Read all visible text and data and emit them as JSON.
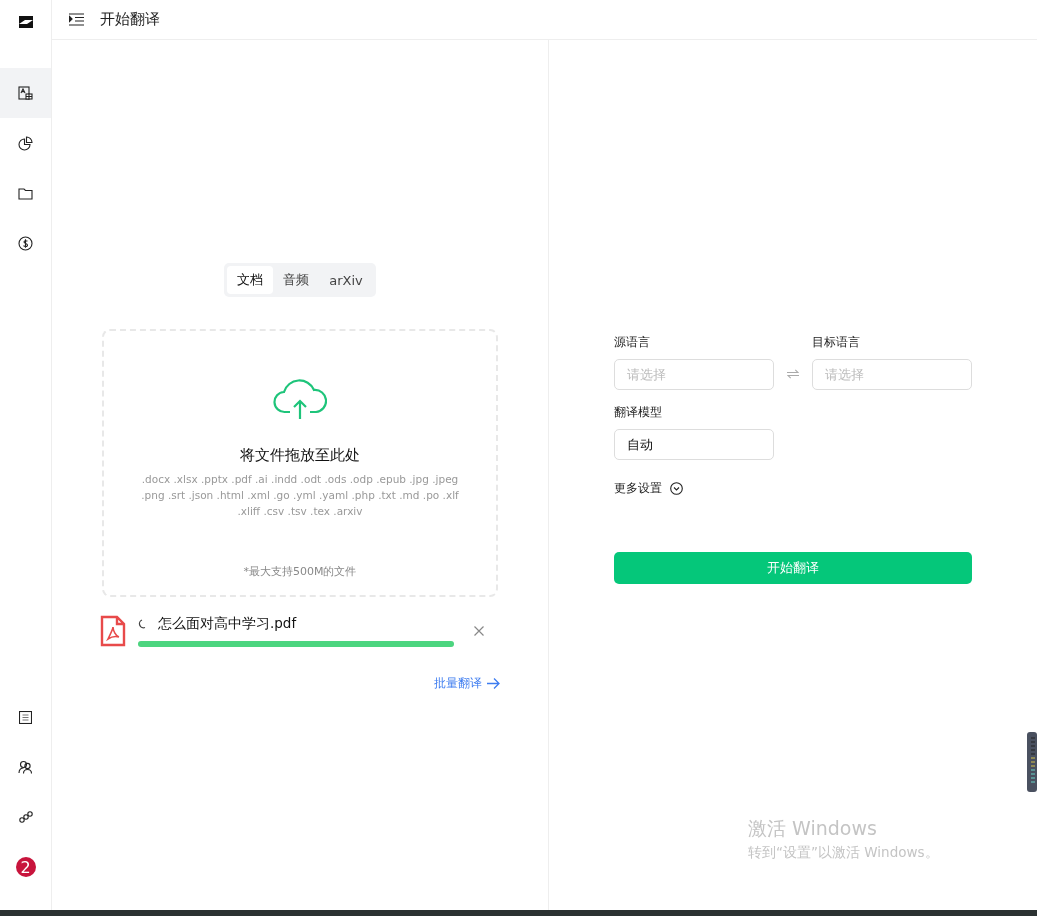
{
  "header": {
    "title": "开始翻译"
  },
  "sidebar": {
    "top_items": [
      {
        "selected": true
      },
      {
        "selected": false
      },
      {
        "selected": false
      },
      {
        "selected": false
      }
    ],
    "notification_badge": "2"
  },
  "upload": {
    "tabs": [
      {
        "label": "文档",
        "selected": true
      },
      {
        "label": "音频",
        "selected": false
      },
      {
        "label": "arXiv",
        "selected": false
      }
    ],
    "drop_title": "将文件拖放至此处",
    "formats": ".docx .xlsx .pptx .pdf .ai .indd .odt .ods .odp .epub .jpg .jpeg .png .srt .json .html .xml .go .yml .yaml .php .txt .md .po .xlf .xliff .csv .tsv .tex .arxiv",
    "size_note": "*最大支持500M的文件",
    "file": {
      "name": "怎么面对高中学习.pdf",
      "level": 1.0
    },
    "batch_link": "批量翻译"
  },
  "settings": {
    "source_label": "源语言",
    "source_placeholder": "请选择",
    "target_label": "目标语言",
    "target_placeholder": "请选择",
    "model_label": "翻译模型",
    "model_value": "自动",
    "more_settings": "更多设置",
    "start_button": "开始翻译"
  },
  "os_overlay": {
    "title": "激活 Windows",
    "subtitle": "转到“设置”以激活 Windows。"
  }
}
